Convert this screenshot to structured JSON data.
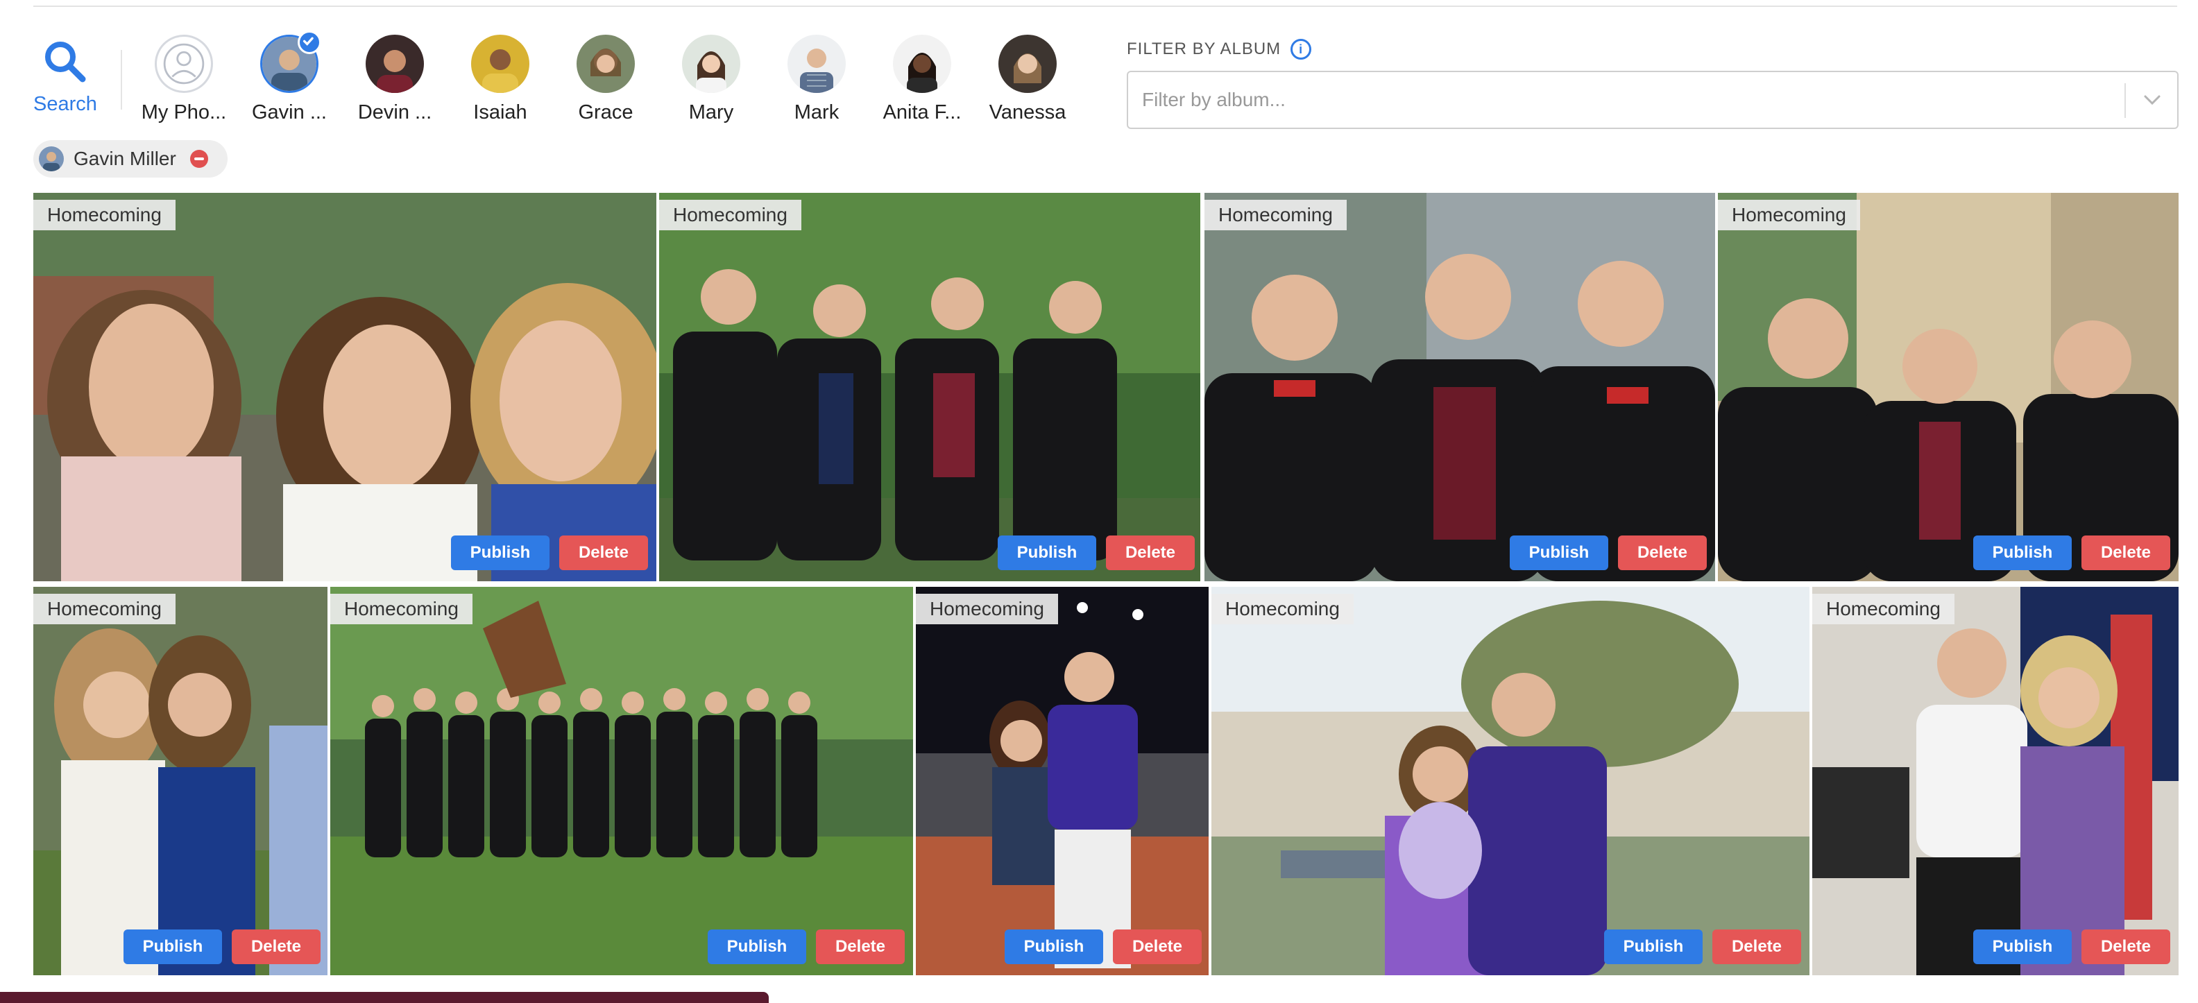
{
  "search": {
    "label": "Search",
    "icon": "search-icon"
  },
  "people": [
    {
      "name": "My Pho...",
      "selected": false
    },
    {
      "name": "Gavin ...",
      "selected": true
    },
    {
      "name": "Devin ...",
      "selected": false
    },
    {
      "name": "Isaiah",
      "selected": false
    },
    {
      "name": "Grace",
      "selected": false
    },
    {
      "name": "Mary",
      "selected": false
    },
    {
      "name": "Mark",
      "selected": false
    },
    {
      "name": "Anita F...",
      "selected": false
    },
    {
      "name": "Vanessa",
      "selected": false
    }
  ],
  "filter": {
    "label": "FILTER BY ALBUM",
    "placeholder": "Filter by album...",
    "value": ""
  },
  "active_filter_chip": {
    "label": "Gavin Miller"
  },
  "photos": [
    {
      "album": "Homecoming",
      "publish": "Publish",
      "delete": "Delete"
    },
    {
      "album": "Homecoming",
      "publish": "Publish",
      "delete": "Delete"
    },
    {
      "album": "Homecoming",
      "publish": "Publish",
      "delete": "Delete"
    },
    {
      "album": "Homecoming",
      "publish": "Publish",
      "delete": "Delete"
    },
    {
      "album": "Homecoming",
      "publish": "Publish",
      "delete": "Delete"
    },
    {
      "album": "Homecoming",
      "publish": "Publish",
      "delete": "Delete"
    },
    {
      "album": "Homecoming",
      "publish": "Publish",
      "delete": "Delete"
    },
    {
      "album": "Homecoming",
      "publish": "Publish",
      "delete": "Delete"
    },
    {
      "album": "Homecoming",
      "publish": "Publish",
      "delete": "Delete"
    }
  ],
  "colors": {
    "accent": "#2f7be5",
    "danger": "#e55656"
  }
}
